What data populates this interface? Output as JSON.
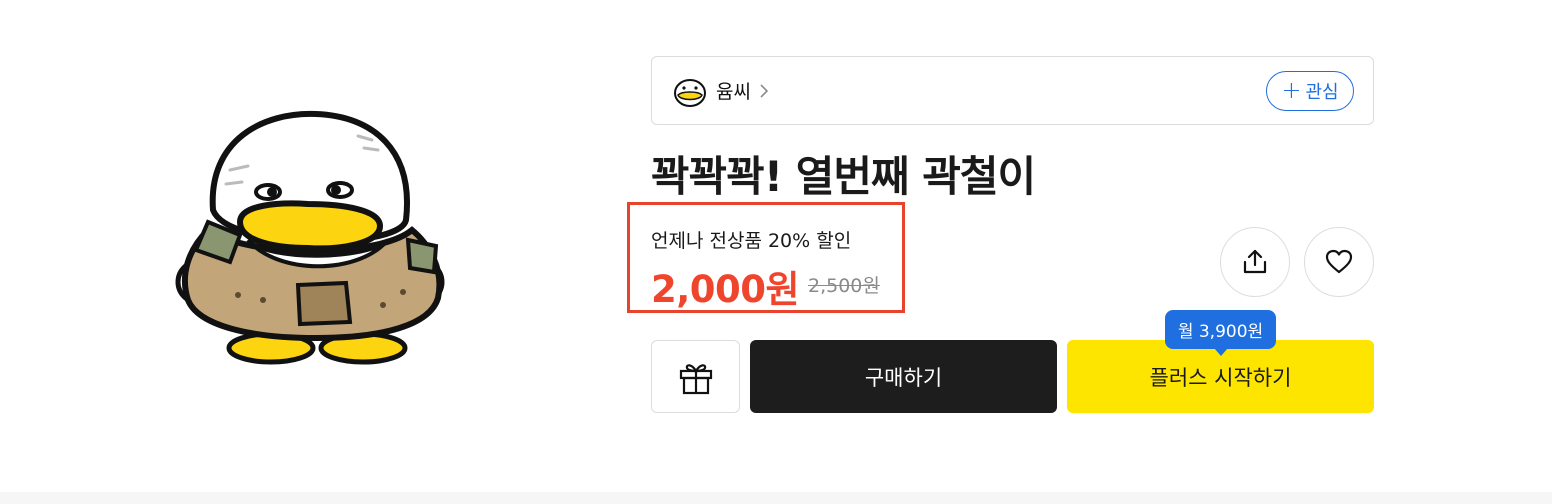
{
  "artist": {
    "name": "윰씨",
    "follow_label": "관심",
    "follow_icon": "plus-icon"
  },
  "product": {
    "title": "꽉꽉꽉! 열번째 곽철이"
  },
  "price": {
    "discount_text": "언제나 전상품 20% 할인",
    "sale_price": "2,000원",
    "original_price": "2,500원"
  },
  "actions": {
    "share_icon": "share-icon",
    "like_icon": "heart-icon",
    "gift_icon": "gift-icon",
    "buy_label": "구매하기",
    "plus_label": "플러스 시작하기",
    "plus_badge": "월 3,900원"
  },
  "colors": {
    "accent_red": "#f0452d",
    "highlight_border": "#e8432d",
    "brand_yellow": "#fee500",
    "brand_blue": "#1f6fe0",
    "buy_black": "#1d1d1d"
  }
}
